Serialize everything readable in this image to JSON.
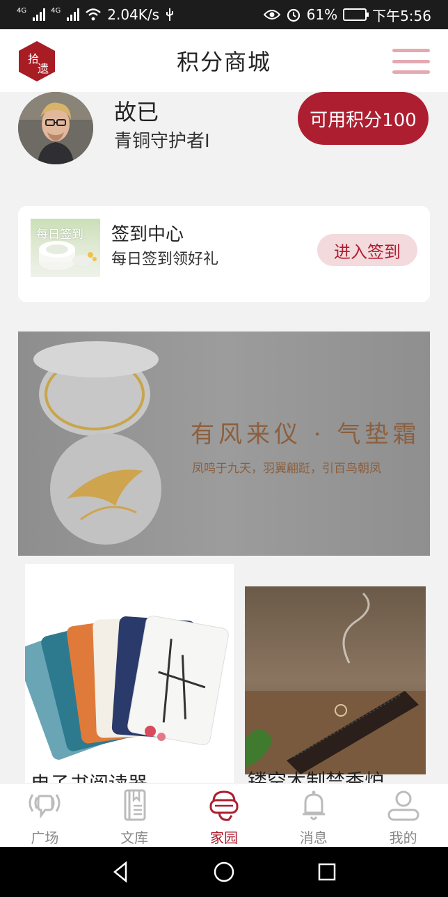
{
  "status_bar": {
    "network_1": "4G",
    "network_2": "4G",
    "speed": "2.04K/s",
    "battery_percent": "61%",
    "battery_level": 0.61,
    "time": "下午5:56"
  },
  "header": {
    "title": "积分商城",
    "logo_text_1": "拾",
    "logo_text_2": "遗"
  },
  "profile": {
    "name": "故已",
    "rank": "青铜守护者I",
    "points_label": "可用积分100"
  },
  "sign_card": {
    "thumb_label": "每日签到",
    "title": "签到中心",
    "subtitle": "每日签到领好礼",
    "button_label": "进入签到"
  },
  "banner": {
    "title": "有风来仪 · 气垫霜",
    "subtitle": "凤鸣于九天，羽翼翩跹，引百鸟朝凤"
  },
  "products": [
    {
      "name": "电子书阅读器"
    },
    {
      "name": "镂空木制禁香炉"
    }
  ],
  "tabbar": {
    "items": [
      {
        "label": "广场",
        "icon": "broadcast-icon"
      },
      {
        "label": "文库",
        "icon": "book-icon"
      },
      {
        "label": "家园",
        "icon": "vr-headset-icon",
        "active": true
      },
      {
        "label": "消息",
        "icon": "bell-icon"
      },
      {
        "label": "我的",
        "icon": "user-icon"
      }
    ]
  },
  "colors": {
    "accent": "#ad1f30",
    "accent_light": "#f3dadd",
    "menu_icon": "#e3aab1",
    "background": "#f2f2f3"
  }
}
